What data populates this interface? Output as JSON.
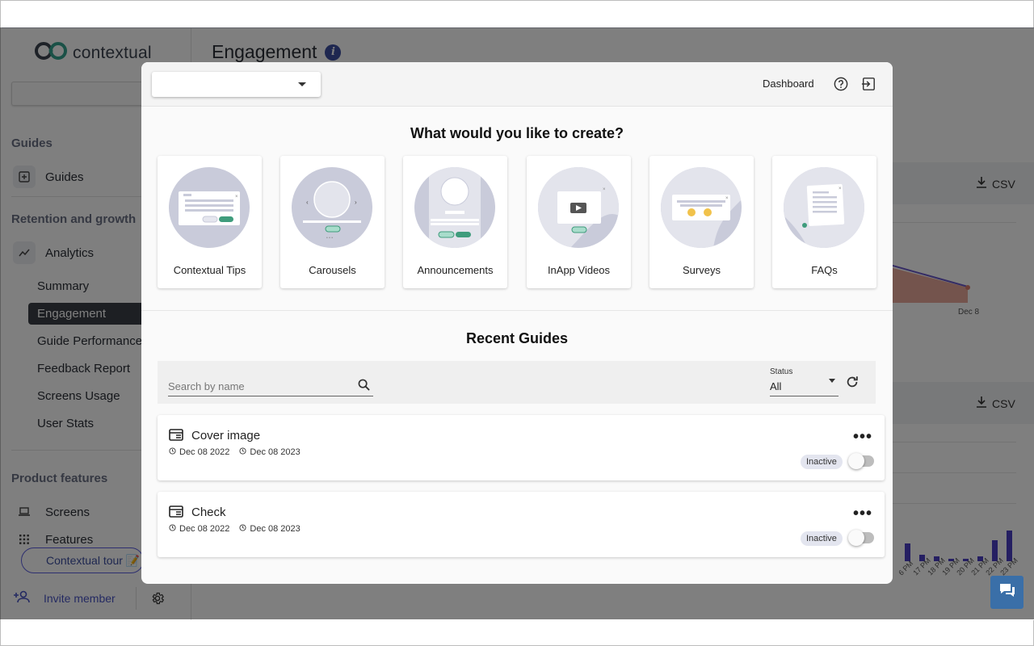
{
  "app": {
    "logo_text": "contextual"
  },
  "sidebar": {
    "sections": {
      "guides": "Guides",
      "retention": "Retention and growth",
      "product": "Product features"
    },
    "guides_item": "Guides",
    "analytics_item": "Analytics",
    "analytics_sub": [
      "Summary",
      "Engagement",
      "Guide Performance",
      "Feedback Report",
      "Screens Usage",
      "User Stats"
    ],
    "screens_item": "Screens",
    "features_item": "Features",
    "tour_button": "Contextual tour 📝",
    "invite": "Invite member"
  },
  "main": {
    "page_title": "Engagement",
    "csv_label": "CSV",
    "chart_dec8": "Dec 8",
    "hour_labels": [
      "6 PM",
      "17 PM",
      "18 PM",
      "19 PM",
      "20 PM",
      "21 PM",
      "22 PM",
      "23 PM"
    ]
  },
  "modal": {
    "header": {
      "dashboard": "Dashboard"
    },
    "question": "What would you like to create?",
    "tiles": [
      "Contextual Tips",
      "Carousels",
      "Announcements",
      "InApp Videos",
      "Surveys",
      "FAQs"
    ],
    "recent_title": "Recent Guides",
    "search": {
      "placeholder": "Search by name"
    },
    "status": {
      "label": "Status",
      "value": "All"
    },
    "guides": [
      {
        "title": "Cover image",
        "start": "Dec 08 2022",
        "end": "Dec 08 2023",
        "status": "Inactive"
      },
      {
        "title": "Check",
        "start": "Dec 08 2022",
        "end": "Dec 08 2023",
        "status": "Inactive"
      }
    ]
  },
  "colors": {
    "accent": "#3d4fa0",
    "tile_circle": "#c9cbda",
    "active_sidebar": "#3b3f47",
    "chat": "#3a6fa8"
  }
}
